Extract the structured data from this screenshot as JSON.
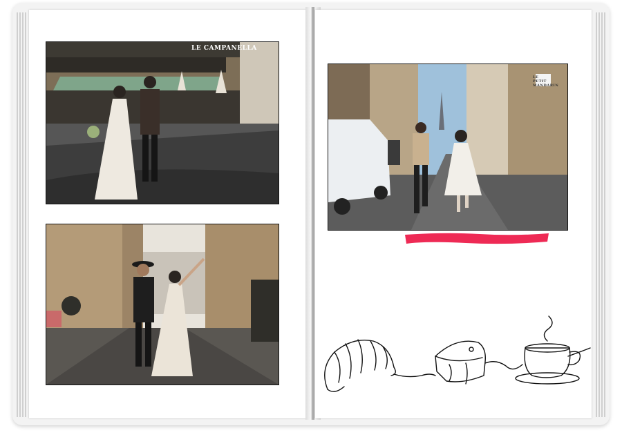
{
  "book": {
    "page_color": "#ffffff",
    "spine_color": "#9a9a9a"
  },
  "left_page": {
    "photos": [
      {
        "subject": "wedding couple walking past Paris café",
        "sign_text": "LE CAMPANELLA"
      },
      {
        "subject": "wedding couple walking hand in hand on Paris street"
      }
    ]
  },
  "right_page": {
    "photo": {
      "subject": "wedding couple running down Paris street with Eiffel Tower",
      "sign_text": "LE PETIT MANDARIN"
    },
    "accent": {
      "color": "#ee2a55",
      "shape": "brush-stroke"
    },
    "line_art": {
      "items": [
        "croissant-icon",
        "cheese-icon",
        "coffee-cup-icon"
      ],
      "color": "#111111"
    }
  }
}
